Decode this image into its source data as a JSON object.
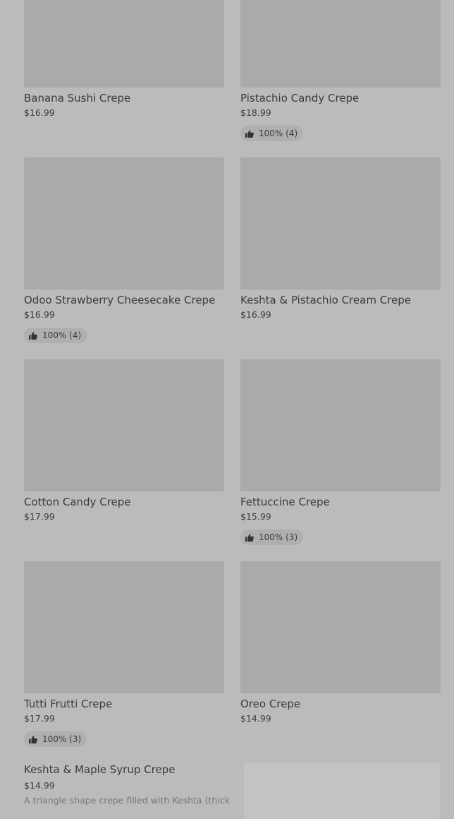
{
  "products": [
    {
      "name": "Banana Sushi Crepe",
      "price": "$16.99",
      "rating": ""
    },
    {
      "name": "Pistachio Candy Crepe",
      "price": "$18.99",
      "rating": "100% (4)"
    },
    {
      "name": "Odoo Strawberry Cheesecake Crepe",
      "price": "$16.99",
      "rating": "100% (4)"
    },
    {
      "name": "Keshta & Pistachio Cream Crepe",
      "price": "$16.99",
      "rating": ""
    },
    {
      "name": "Cotton Candy Crepe",
      "price": "$17.99",
      "rating": ""
    },
    {
      "name": "Fettuccine Crepe",
      "price": "$15.99",
      "rating": "100% (3)"
    },
    {
      "name": "Tutti Frutti Crepe",
      "price": "$17.99",
      "rating": "100% (3)"
    },
    {
      "name": "Oreo Crepe",
      "price": "$14.99",
      "rating": ""
    }
  ],
  "featured": {
    "name": "Keshta & Maple Syrup Crepe",
    "price": "$14.99",
    "description": "A triangle shape crepe filled with Keshta (thick"
  },
  "icons": {
    "rating": "thumbs-up-icon"
  },
  "colors": {
    "background": "#bbbbbb",
    "image_placeholder": "#aaaaaa",
    "badge": "#afafaf"
  }
}
